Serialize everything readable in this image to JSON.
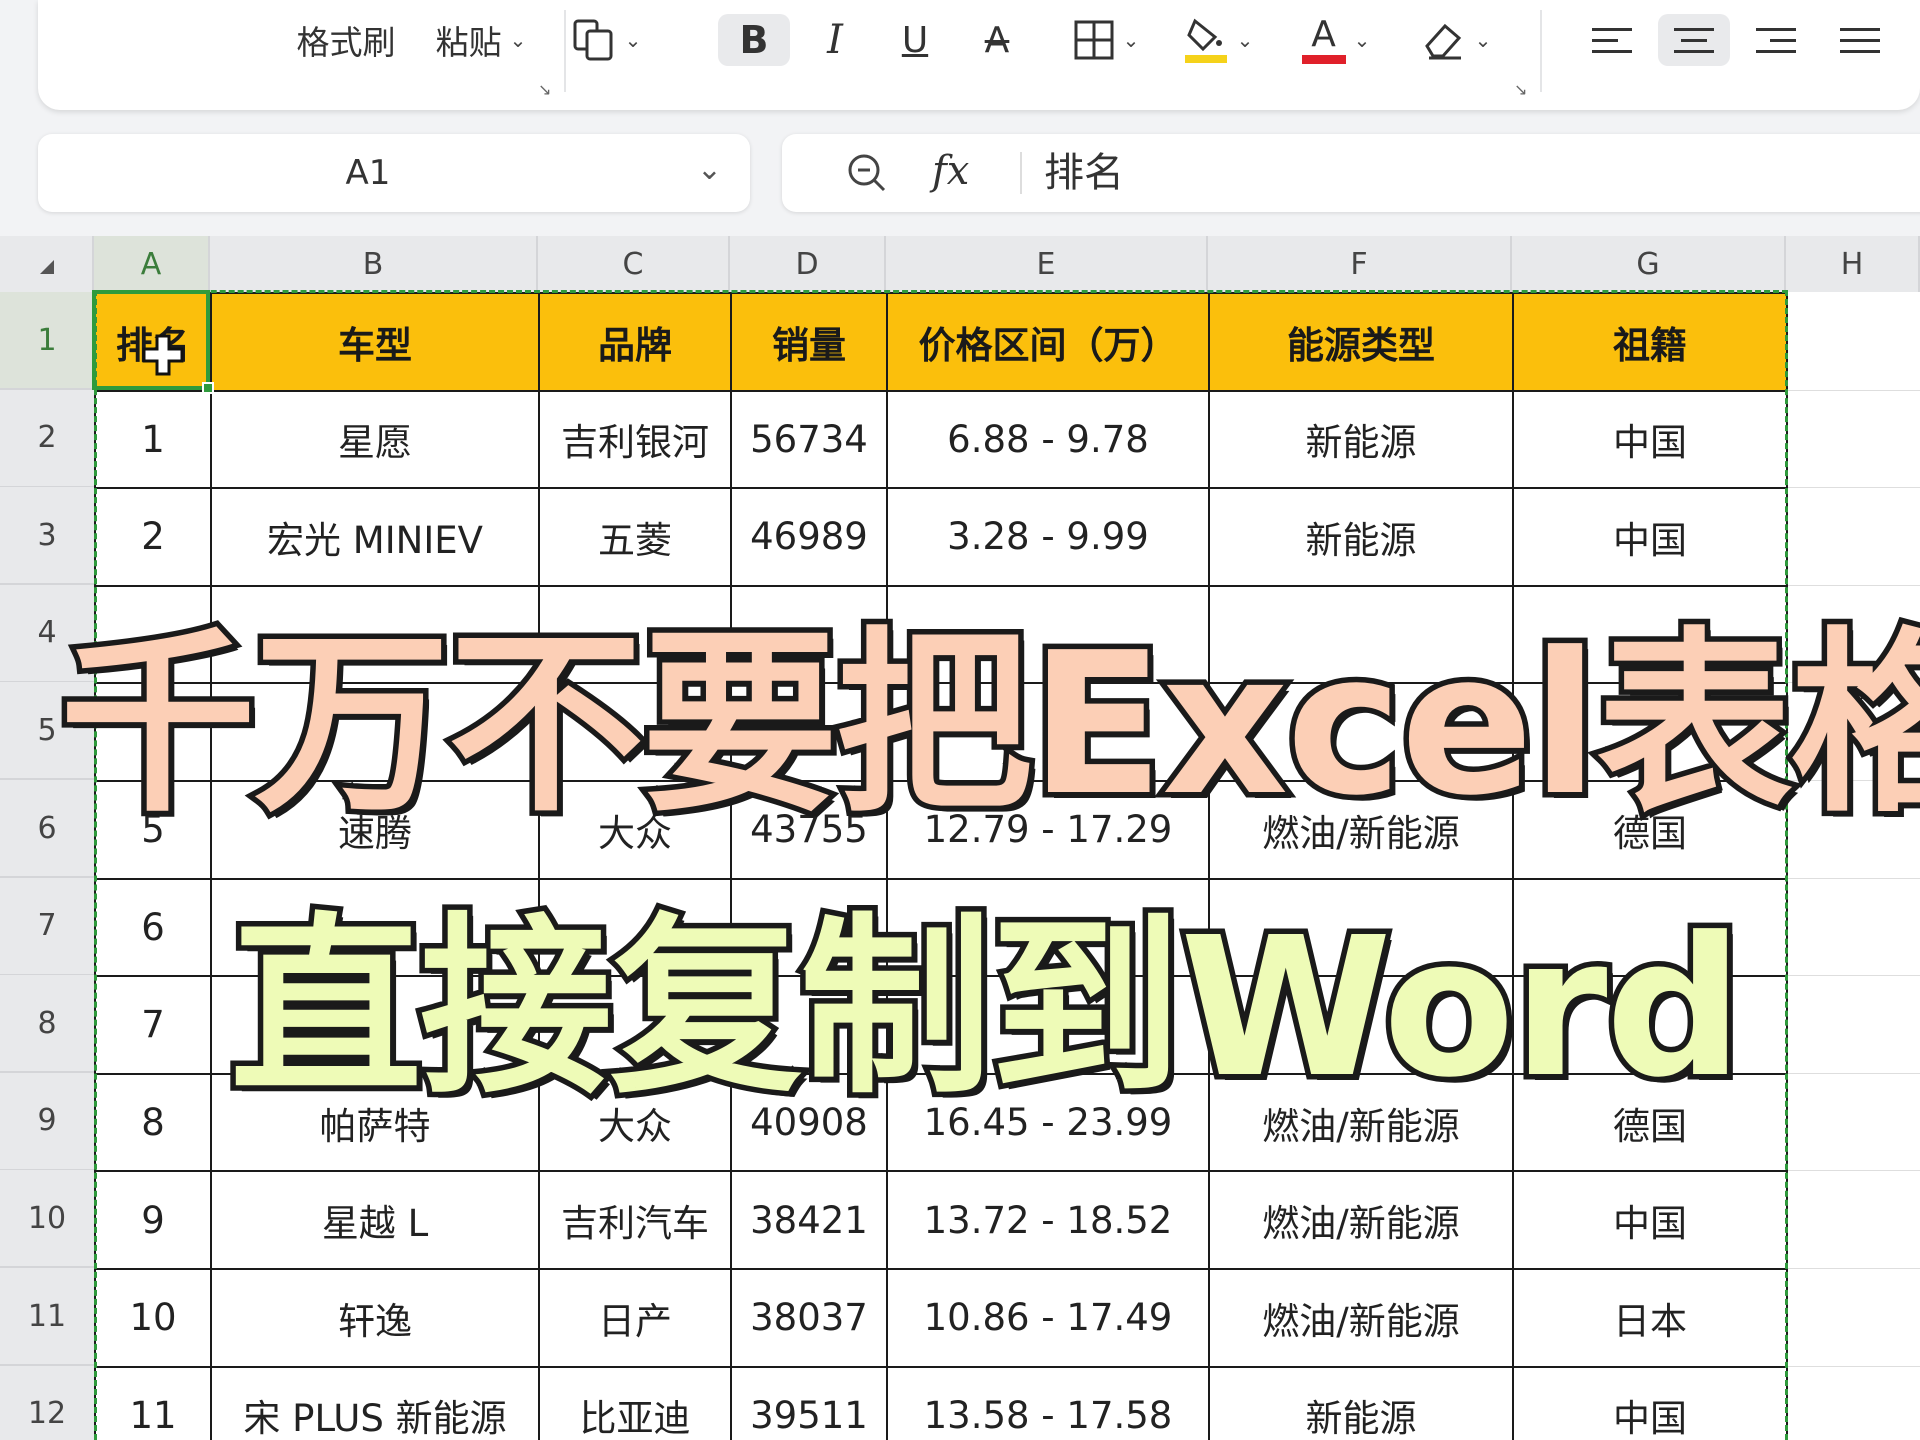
{
  "toolbar": {
    "paint_format": "格式刷",
    "paste": "粘贴",
    "bold": "B",
    "italic": "I",
    "underline": "U",
    "strike": "A",
    "font_color_letter": "A",
    "fill_color": "#f5d21a",
    "font_color": "#e0202a",
    "dropdown": "⌄"
  },
  "namebox": {
    "ref": "A1"
  },
  "formula_bar": {
    "fx": "fx",
    "value": "排名"
  },
  "columns": [
    "A",
    "B",
    "C",
    "D",
    "E",
    "F",
    "G",
    "H"
  ],
  "rows": [
    "1",
    "2",
    "3",
    "4",
    "5",
    "6",
    "7",
    "8",
    "9",
    "10",
    "11",
    "12"
  ],
  "table": {
    "header": [
      "排名",
      "车型",
      "品牌",
      "销量",
      "价格区间（万）",
      "能源类型",
      "祖籍"
    ],
    "rows": [
      [
        "1",
        "星愿",
        "吉利银河",
        "56734",
        "6.88 - 9.78",
        "新能源",
        "中国"
      ],
      [
        "2",
        "宏光 MINIEV",
        "五菱",
        "46989",
        "3.28 - 9.99",
        "新能源",
        "中国"
      ],
      [
        "",
        "",
        "",
        "",
        "",
        "",
        ""
      ],
      [
        "",
        "",
        "",
        "",
        "",
        "",
        ""
      ],
      [
        "5",
        "速腾",
        "大众",
        "43755",
        "12.79 - 17.29",
        "燃油/新能源",
        "德国"
      ],
      [
        "6",
        "",
        "",
        "",
        "",
        "",
        ""
      ],
      [
        "7",
        "",
        "",
        "",
        "",
        "",
        ""
      ],
      [
        "8",
        "帕萨特",
        "大众",
        "40908",
        "16.45 - 23.99",
        "燃油/新能源",
        "德国"
      ],
      [
        "9",
        "星越 L",
        "吉利汽车",
        "38421",
        "13.72 - 18.52",
        "燃油/新能源",
        "中国"
      ],
      [
        "10",
        "轩逸",
        "日产",
        "38037",
        "10.86 - 17.49",
        "燃油/新能源",
        "日本"
      ],
      [
        "11",
        "宋 PLUS 新能源",
        "比亚迪",
        "39511",
        "13.58 - 17.58",
        "新能源",
        "中国"
      ]
    ]
  },
  "caption": {
    "line1": "千万不要把Excel表格",
    "line2": "直接复制到Word"
  },
  "colors": {
    "header_fill": "#fbbf0c",
    "selection_green": "#2f9a3c",
    "caption1_fill": "#fccfb6",
    "caption2_fill": "#eefbb7"
  }
}
